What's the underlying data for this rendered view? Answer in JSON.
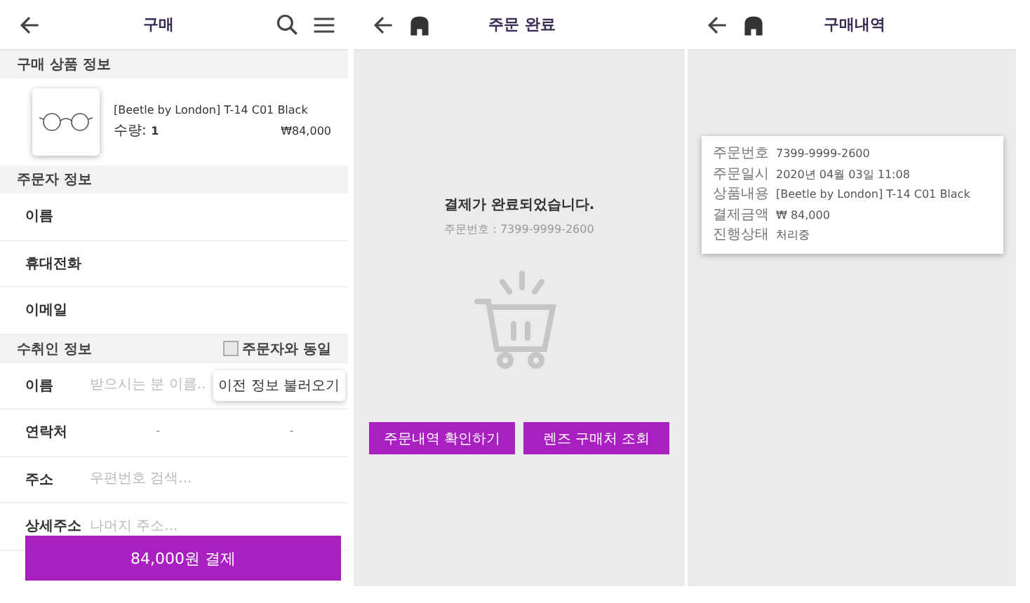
{
  "purchase": {
    "title": "구매",
    "product_section": "구매 상품 정보",
    "product": {
      "name": "[Beetle by London] T-14 C01 Black",
      "quantity_label": "수량:",
      "quantity": "1",
      "price": "₩84,000"
    },
    "orderer_section": "주문자 정보",
    "orderer_fields": [
      {
        "label": "이름"
      },
      {
        "label": "휴대전화"
      },
      {
        "label": "이메일"
      }
    ],
    "recipient_section": "수취인 정보",
    "same_as_orderer": {
      "label": "주문자와 동일",
      "checked": false
    },
    "recipient_fields": [
      {
        "kind": "input",
        "label": "이름",
        "placeholder": "받으시는 분 이름..",
        "button": "이전 정보 불러오기"
      },
      {
        "kind": "phone",
        "label": "연락처",
        "separators": [
          "-",
          "-"
        ]
      },
      {
        "kind": "input",
        "label": "주소",
        "placeholder": "우편번호 검색..."
      },
      {
        "kind": "input",
        "label": "상세주소",
        "placeholder": "나머지 주소..."
      }
    ],
    "pay_button": "84,000원 결제"
  },
  "complete": {
    "title": "주문 완료",
    "message": "결제가 완료되었습니다.",
    "order_number": "주문번호 : 7399-9999-2600",
    "buttons": [
      "주문내역 확인하기",
      "렌즈 구매처 조회"
    ]
  },
  "history": {
    "title": "구매내역",
    "rows": [
      {
        "label": "주문번호",
        "value": "7399-9999-2600"
      },
      {
        "label": "주문일시",
        "value": "2020년 04월 03일 11:08"
      },
      {
        "label": "상품내용",
        "value": "[Beetle by London] T-14 C01 Black"
      },
      {
        "label": "결제금액",
        "value": "₩ 84,000"
      },
      {
        "label": "진행상태",
        "value": "처리중"
      }
    ]
  }
}
